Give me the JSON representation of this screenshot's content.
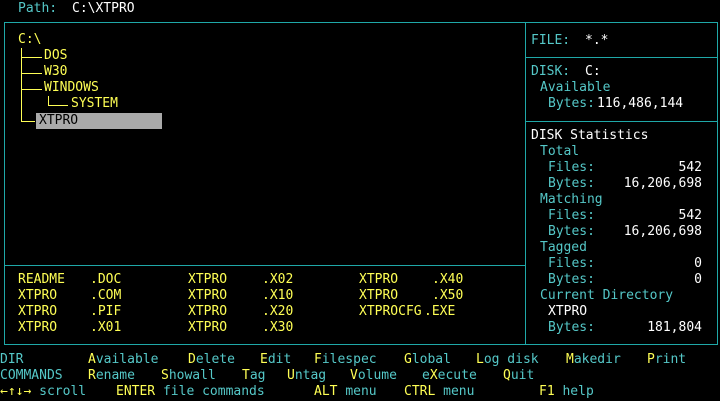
{
  "path": {
    "label": "Path:",
    "value": "C:\\XTPRO"
  },
  "tree": {
    "root": "C:\\",
    "items": [
      {
        "name": "DOS",
        "depth": 1
      },
      {
        "name": "W30",
        "depth": 1
      },
      {
        "name": "WINDOWS",
        "depth": 1
      },
      {
        "name": "SYSTEM",
        "depth": 2
      },
      {
        "name": "XTPRO",
        "depth": 1,
        "selected": true
      }
    ]
  },
  "files": [
    [
      "README",
      ".DOC"
    ],
    [
      "XTPRO",
      ".X02"
    ],
    [
      "XTPRO",
      ".X40"
    ],
    [
      "XTPRO",
      ".COM"
    ],
    [
      "XTPRO",
      ".X10"
    ],
    [
      "XTPRO",
      ".X50"
    ],
    [
      "XTPRO",
      ".PIF"
    ],
    [
      "XTPRO",
      ".X20"
    ],
    [
      "XTPROCFG",
      ".EXE"
    ],
    [
      "XTPRO",
      ".X01"
    ],
    [
      "XTPRO",
      ".X30"
    ]
  ],
  "info": {
    "file_label": "FILE:",
    "file_value": "*.*",
    "disk_label": "DISK:",
    "disk_value": "C:",
    "available_label": "Available",
    "bytes_label": "Bytes:",
    "available_bytes": "116,486,144",
    "stats_title": "DISK Statistics",
    "total_label": "Total",
    "files_label": "Files:",
    "total_files": "542",
    "total_bytes": "16,206,698",
    "matching_label": "Matching",
    "matching_files": "542",
    "matching_bytes": "16,206,698",
    "tagged_label": "Tagged",
    "tagged_files": "0",
    "tagged_bytes": "0",
    "current_dir_label": "Current Directory",
    "current_dir": "XTPRO",
    "current_dir_bytes": "181,804"
  },
  "menu": {
    "dir_label": "DIR",
    "dir_items": [
      {
        "hot": "A",
        "rest": "vailable"
      },
      {
        "hot": "D",
        "rest": "elete"
      },
      {
        "hot": "E",
        "rest": "dit"
      },
      {
        "hot": "F",
        "rest": "ilespec"
      },
      {
        "hot": "G",
        "rest": "lobal"
      },
      {
        "hot": "L",
        "rest": "og disk"
      },
      {
        "hot": "M",
        "rest": "akedir"
      },
      {
        "hot": "P",
        "rest": "rint"
      }
    ],
    "commands_label": "COMMANDS",
    "commands_items": [
      {
        "hot": "R",
        "rest": "ename"
      },
      {
        "hot": "S",
        "rest": "howall"
      },
      {
        "hot": "T",
        "rest": "ag"
      },
      {
        "hot": "U",
        "rest": "ntag"
      },
      {
        "hot": "V",
        "rest": "olume"
      },
      {
        "pre": "e",
        "hot": "X",
        "rest": "ecute"
      },
      {
        "hot": "Q",
        "rest": "uit"
      }
    ],
    "scroll_keys": "←↑↓→",
    "scroll_label": "scroll",
    "enter_key": "ENTER",
    "enter_label": "file commands",
    "alt_key": "ALT",
    "alt_label": "menu",
    "ctrl_key": "CTRL",
    "ctrl_label": "menu",
    "f1_key": "F1",
    "f1_label": "help"
  }
}
